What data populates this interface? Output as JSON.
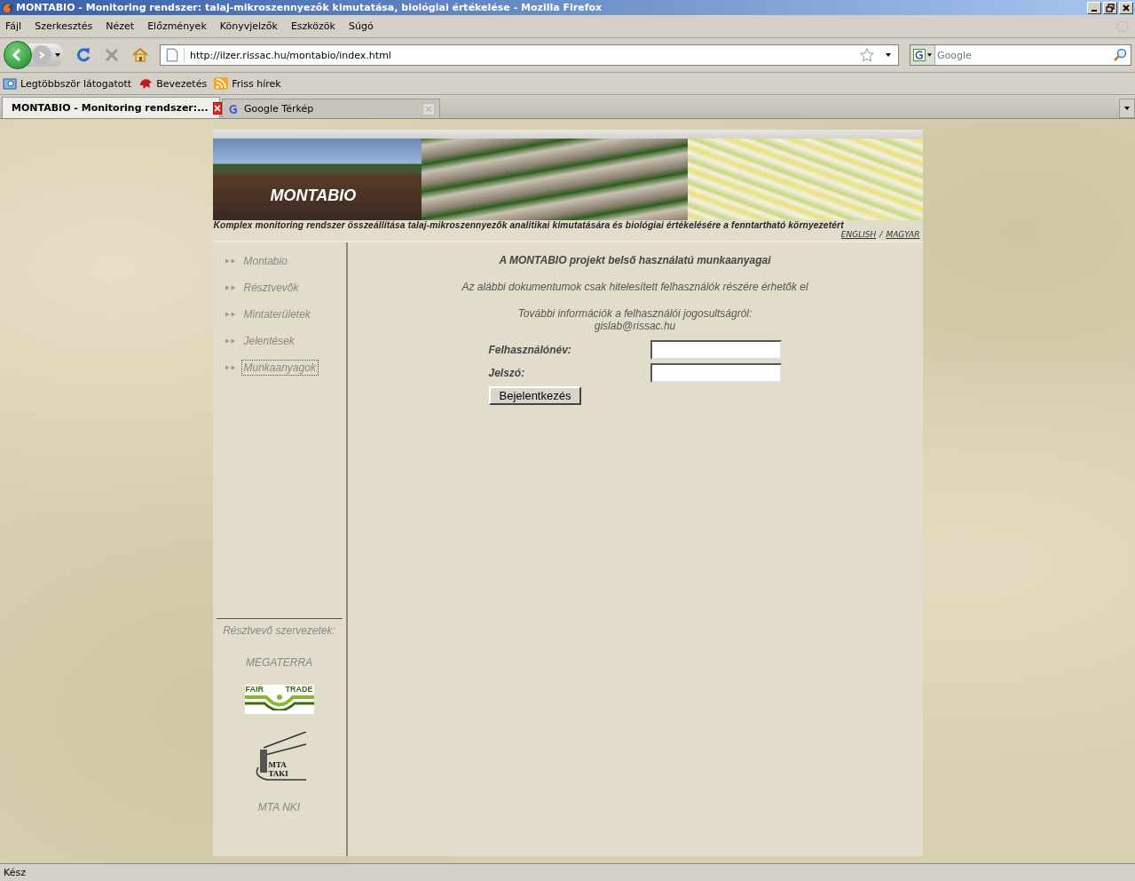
{
  "window": {
    "title": "MONTABIO - Monitoring rendszer: talaj-mikroszennyezők kimutatása, biológiai értékelése - Mozilla Firefox"
  },
  "menu": [
    "Fájl",
    "Szerkesztés",
    "Nézet",
    "Előzmények",
    "Könyvjelzők",
    "Eszközök",
    "Súgó"
  ],
  "address": {
    "value": "http://ilzer.rissac.hu/montabio/index.html"
  },
  "search": {
    "placeholder": "Google"
  },
  "bookmarks": [
    {
      "label": "Legtöbbször látogatott",
      "kind": "smart"
    },
    {
      "label": "Bevezetés",
      "kind": "site"
    },
    {
      "label": "Friss hírek",
      "kind": "feed"
    }
  ],
  "tabs": [
    {
      "label": "MONTABIO - Monitoring rendszer:...",
      "selected": true,
      "kind": "page"
    },
    {
      "label": "Google Térkép",
      "selected": false,
      "kind": "google"
    }
  ],
  "page": {
    "banner_title": "MONTABIO",
    "subtitle": "Komplex monitoring rendszer összeállítása talaj-mikroszennyezők analitikai kimutatására és biológiai értékelésére a fenntartható környezetért",
    "languages": [
      "ENGLISH",
      "MAGYAR"
    ],
    "language_separator": "/",
    "nav": [
      {
        "label": "Montabio",
        "selected": false
      },
      {
        "label": "Résztvevők",
        "selected": false
      },
      {
        "label": "Mintaterületek",
        "selected": false
      },
      {
        "label": "Jelentések",
        "selected": false
      },
      {
        "label": "Munkaanyagok",
        "selected": true
      }
    ],
    "partners_heading": "Résztvevő szervezetek:",
    "partners": [
      {
        "kind": "text",
        "label": "MEGATERRA"
      },
      {
        "kind": "fairtrade",
        "words": [
          "FAIR",
          "TRADE"
        ]
      },
      {
        "kind": "taki",
        "label": "MTA TAKI"
      },
      {
        "kind": "text",
        "label": "MTA NKI"
      }
    ],
    "heading": "A MONTABIO projekt belső használatú munkaanyagai",
    "notice": "Az alábbi dokumentumok csak hitelesített felhasználók részére érhetők el",
    "info": "További információk a felhasználói jogosultságról:",
    "email": "gislab@rissac.hu",
    "form": {
      "fields": [
        {
          "label": "Felhasználónév:"
        },
        {
          "label": "Jelszó:"
        }
      ],
      "button": "Bejelentkezés"
    }
  },
  "status_bar": "Kész"
}
